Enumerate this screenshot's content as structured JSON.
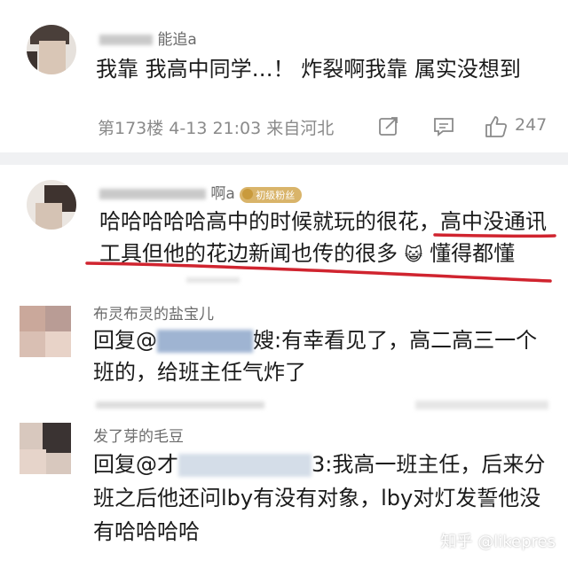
{
  "comments": [
    {
      "name_visible": "能追a",
      "text": "我靠 我高中同学…！ 炸裂啊我靠 属实没想到",
      "meta": "第173楼 4-13 21:03 来自河北",
      "like_count": "247"
    },
    {
      "name_visible": "啊a",
      "badge": "初级粉丝",
      "line1_a": "哈哈哈哈哈高中的时候就玩的很花，",
      "line1_b": "高中没通讯",
      "line2_a": "工具但他的花边新闻也传的很多",
      "line2_b": "懂得都懂",
      "emoji": "😺"
    },
    {
      "name_visible": "布灵布灵的盐宝儿",
      "line1_prefix": "回复@",
      "line1_suffix": "嫂:有幸看见了，高二高三一个",
      "line2": "班的，给班主任气炸了"
    },
    {
      "name_visible": "发了芽的毛豆",
      "line1_prefix": "回复@",
      "line1_mid": "才",
      "line1_suffix": "3:我高一班主任，后来分",
      "line2": "班之后他还问lby有没有对象，lby对灯发誓他没",
      "line3": "有哈哈哈哈"
    }
  ],
  "watermark": "知乎 @likepres",
  "colors": {
    "underline": "#d0242f",
    "separator": "#f0f1f3",
    "meta": "#8a8a8a"
  },
  "icons": [
    "share-icon",
    "comment-icon",
    "like-icon"
  ]
}
